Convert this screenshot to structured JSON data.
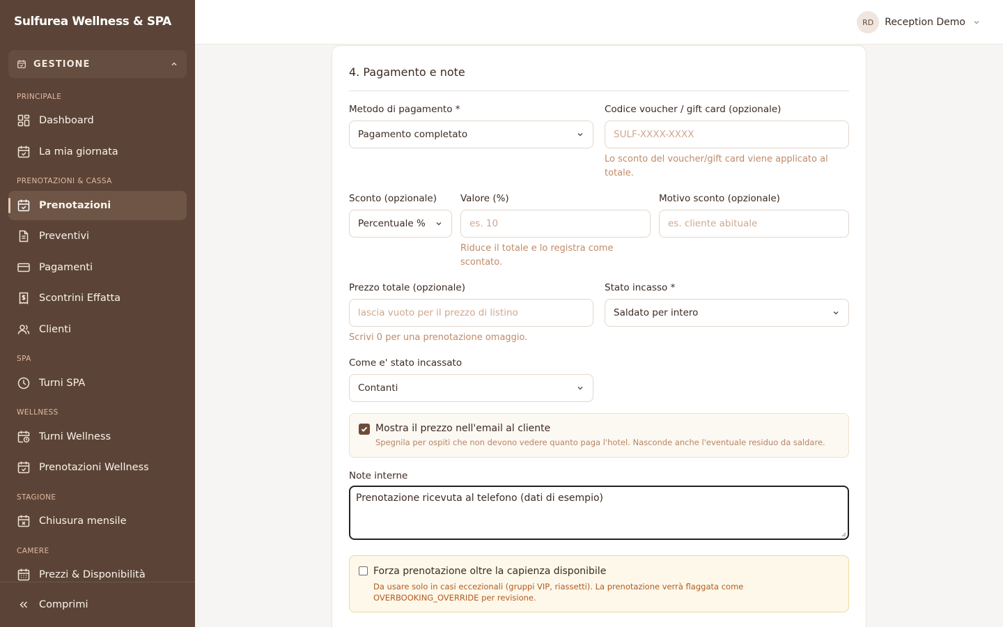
{
  "brand": "Sulfurea Wellness & SPA",
  "sidebar": {
    "group_label": "GESTIONE",
    "sections": {
      "principale": "PRINCIPALE",
      "prenotazioni_cassa": "PRENOTAZIONI & CASSA",
      "spa": "SPA",
      "wellness": "WELLNESS",
      "stagione": "STAGIONE",
      "camere": "CAMERE"
    },
    "items": {
      "dashboard": "Dashboard",
      "la_mia_giornata": "La mia giornata",
      "prenotazioni": "Prenotazioni",
      "preventivi": "Preventivi",
      "pagamenti": "Pagamenti",
      "scontrini": "Scontrini Effatta",
      "clienti": "Clienti",
      "turni_spa": "Turni SPA",
      "turni_wellness": "Turni Wellness",
      "prenotazioni_wellness": "Prenotazioni Wellness",
      "chiusura_mensile": "Chiusura mensile",
      "prezzi_disponibilita": "Prezzi & Disponibilità"
    },
    "collapse_label": "Comprimi"
  },
  "user": {
    "initials": "RD",
    "name": "Reception Demo"
  },
  "form": {
    "section_title": "4. Pagamento e note",
    "payment_method": {
      "label": "Metodo di pagamento *",
      "value": "Pagamento completato"
    },
    "voucher": {
      "label": "Codice voucher / gift card (opzionale)",
      "placeholder": "SULF-XXXX-XXXX",
      "hint_line1": "Lo sconto del voucher/gift card viene applicato al",
      "hint_line2": "totale."
    },
    "discount_type": {
      "label": "Sconto (opzionale)",
      "value": "Percentuale %"
    },
    "discount_value": {
      "label": "Valore (%)",
      "placeholder": "es. 10",
      "hint_line1": "Riduce il totale e lo registra come",
      "hint_line2": "scontato."
    },
    "discount_reason": {
      "label": "Motivo sconto (opzionale)",
      "placeholder": "es. cliente abituale"
    },
    "total_price": {
      "label": "Prezzo totale (opzionale)",
      "placeholder": "lascia vuoto per il prezzo di listino",
      "hint": "Scrivi 0 per una prenotazione omaggio."
    },
    "payment_status": {
      "label": "Stato incasso *",
      "value": "Saldato per intero"
    },
    "collection_method": {
      "label": "Come e' stato incassato",
      "value": "Contanti"
    },
    "show_price": {
      "checked": true,
      "title": "Mostra il prezzo nell'email al cliente",
      "subtitle": "Spegnila per ospiti che non devono vedere quanto paga l'hotel. Nasconde anche l'eventuale residuo da saldare."
    },
    "notes": {
      "label": "Note interne",
      "value": "Prenotazione ricevuta al telefono (dati di esempio)"
    },
    "force_booking": {
      "checked": false,
      "title": "Forza prenotazione oltre la capienza disponibile",
      "subtitle": "Da usare solo in casi eccezionali (gruppi VIP, riassetti). La prenotazione verrà flaggata come OVERBOOKING_OVERRIDE per revisione."
    }
  },
  "colors": {
    "sidebar_bg": "#5b4437",
    "accent": "#6e4b38",
    "hint": "#c08a68",
    "warning_text": "#b35a1f"
  }
}
